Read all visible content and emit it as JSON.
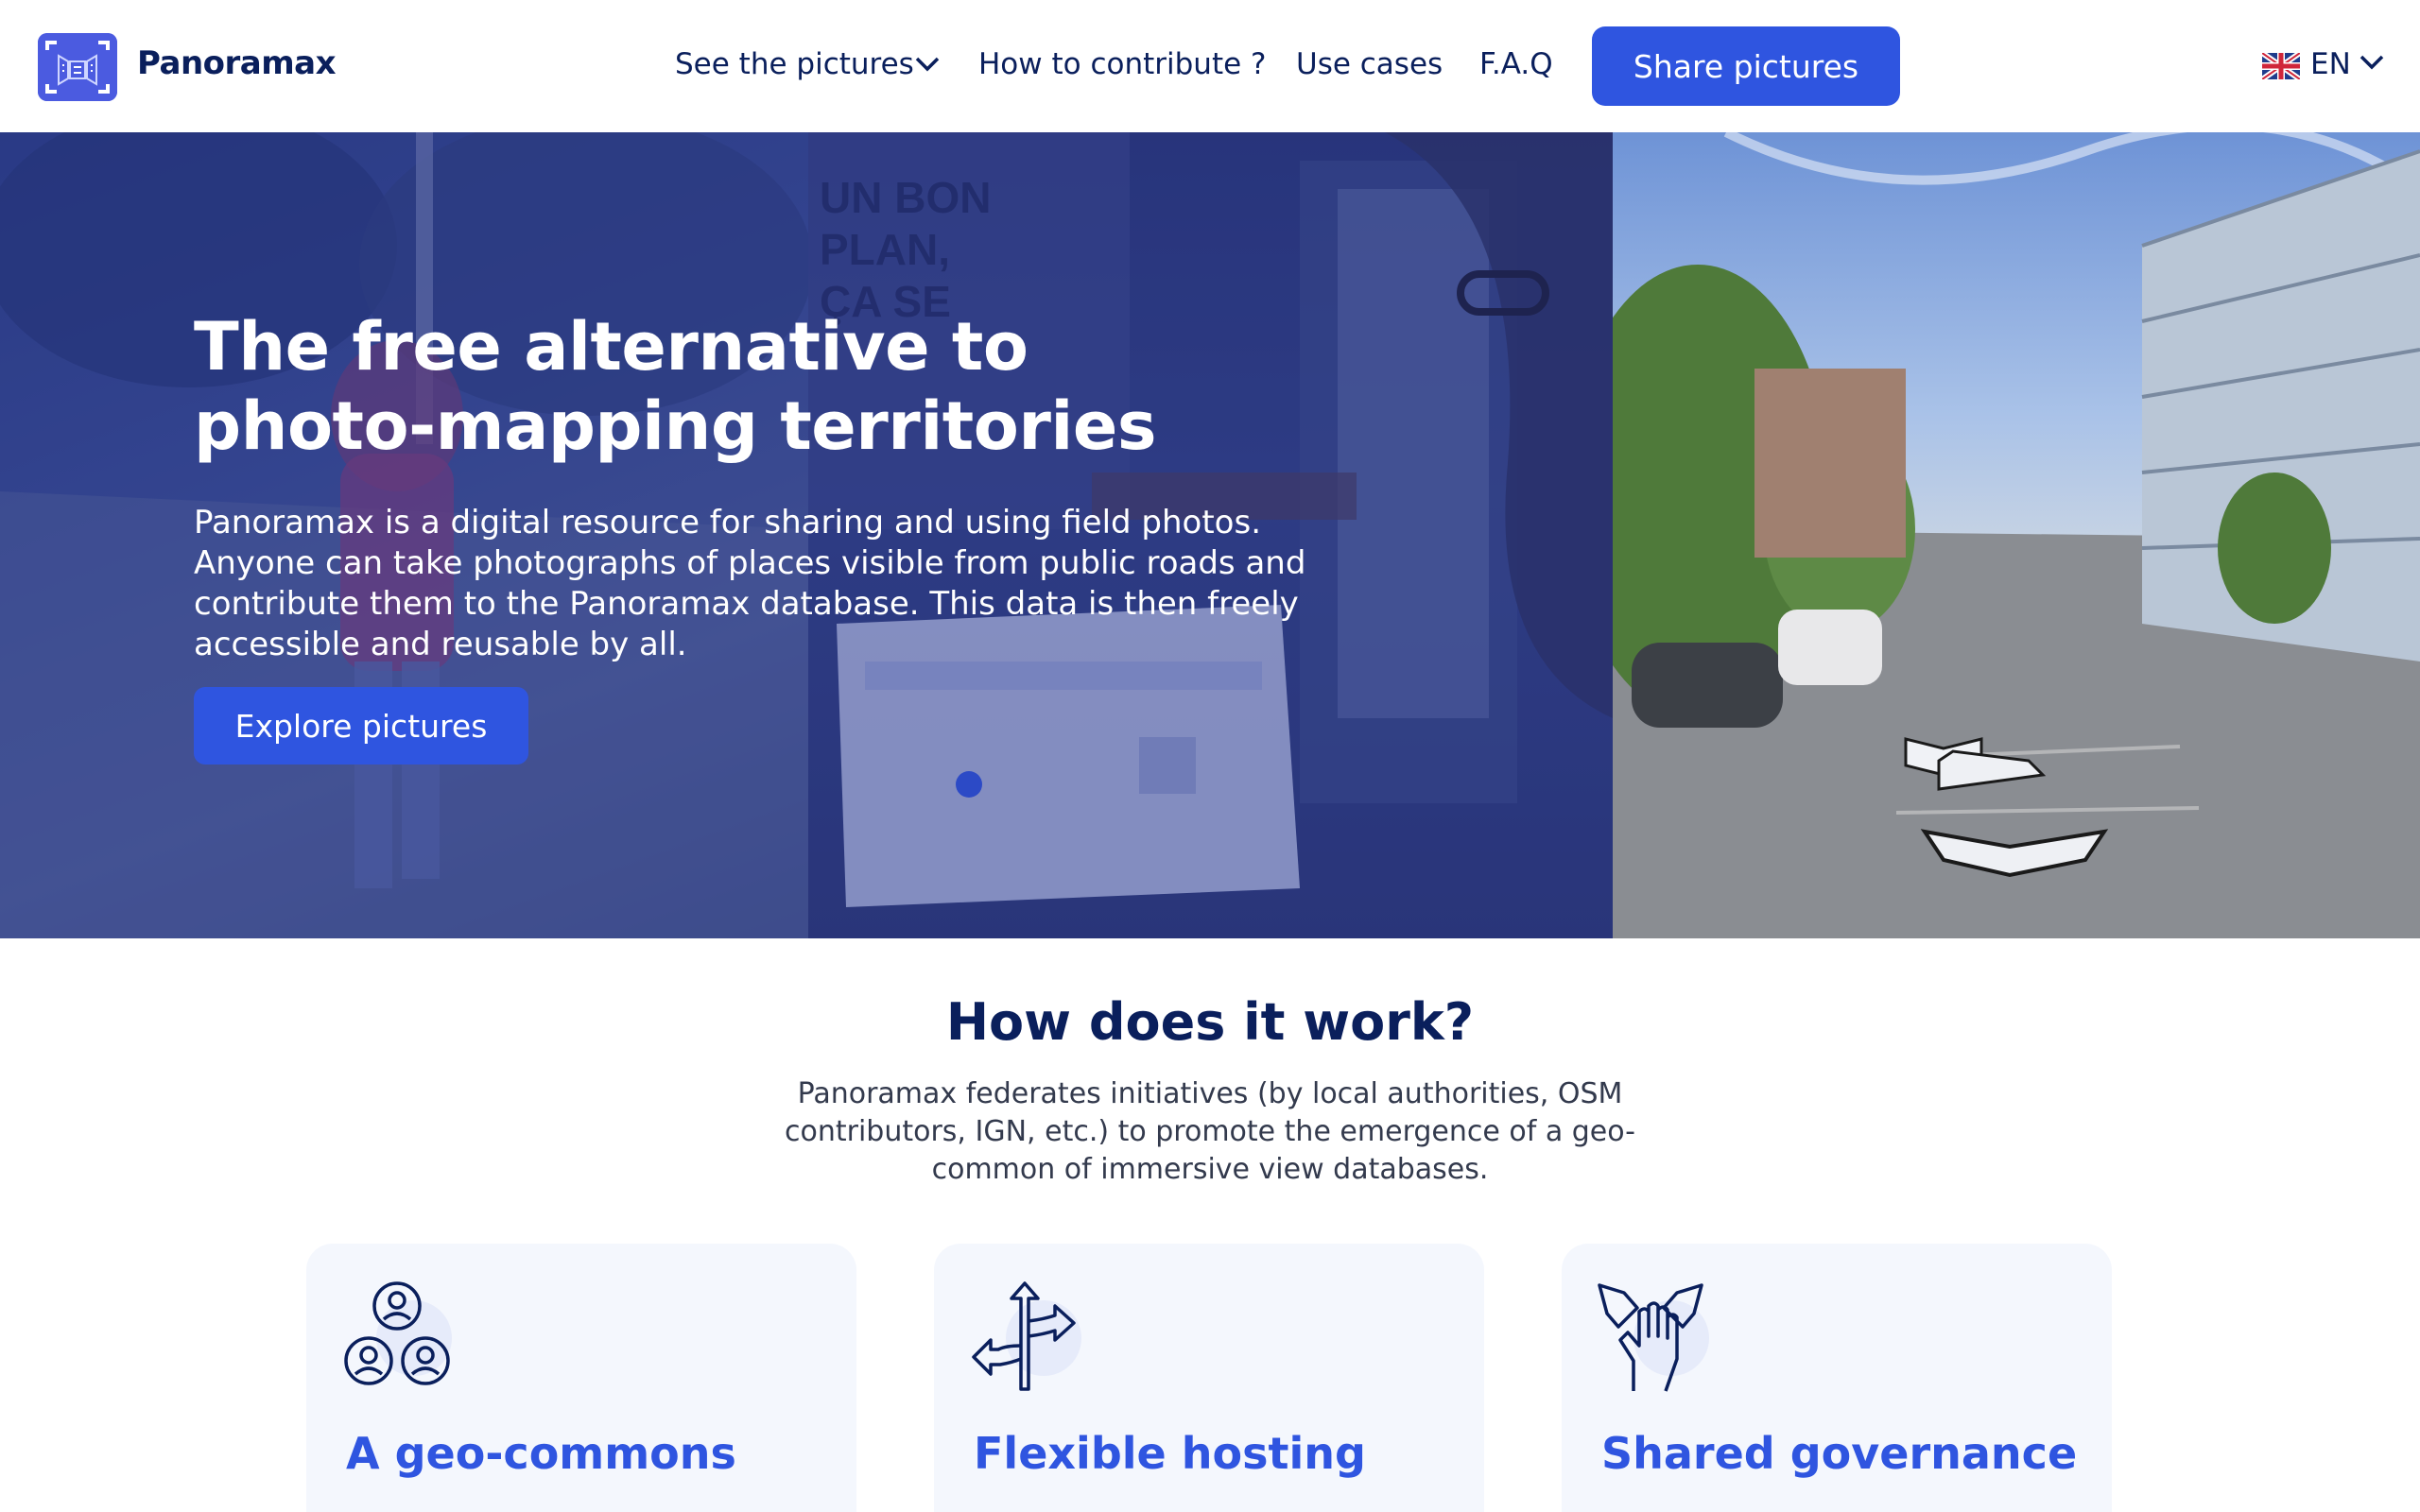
{
  "header": {
    "brand": "Panoramax",
    "nav": {
      "see_pictures": "See the pictures",
      "how_to_contribute": "How to contribute ?",
      "use_cases": "Use cases",
      "faq": "F.A.Q"
    },
    "share_button": "Share pictures",
    "language": "EN"
  },
  "hero": {
    "title": "The free alternative to photo-mapping territories",
    "description": "Panoramax is a digital resource for sharing and using field photos. Anyone can take photographs of places visible from public roads and contribute them to the Panoramax database. This data is then freely accessible and reusable by all.",
    "explore_button": "Explore pictures"
  },
  "how": {
    "title": "How does it work?",
    "description": "Panoramax federates initiatives (by local authorities, OSM contributors, IGN, etc.) to promote the emergence of a geo-common of immersive view databases.",
    "cards": [
      {
        "title": "A geo-commons",
        "icon": "community-icon"
      },
      {
        "title": "Flexible hosting",
        "icon": "directions-arrows-icon"
      },
      {
        "title": "Shared governance",
        "icon": "handshake-hands-icon"
      }
    ]
  },
  "colors": {
    "primary": "#2f55e0",
    "navy": "#0a1f5c",
    "card_bg": "#f4f7fd"
  }
}
